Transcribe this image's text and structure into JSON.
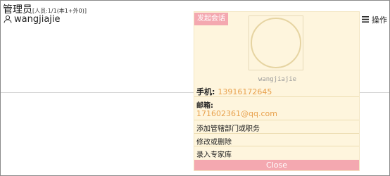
{
  "group": {
    "name": "管理员",
    "count": "[人员:1/1(本1+外0)]"
  },
  "member": {
    "icon": "person-icon",
    "name": "wangjiajie"
  },
  "toolbar": {
    "menu_icon": "hamburger-menu-icon",
    "ops_label": "操作"
  },
  "popup": {
    "start_chat": "发起会话",
    "avatar_icon": "avatar-placeholder",
    "username": "wangjiajie",
    "phone_label": "手机:",
    "phone": "13916172645",
    "email_label": "邮箱:",
    "email": "171602361@qq.com",
    "actions": [
      "添加管辖部门或职务",
      "修改或删除",
      "录入专家库"
    ],
    "close": "Close"
  },
  "colors": {
    "accent_pink": "#f4a8b0",
    "popup_bg": "#fef5dd",
    "value_orange": "#e8a04b"
  }
}
